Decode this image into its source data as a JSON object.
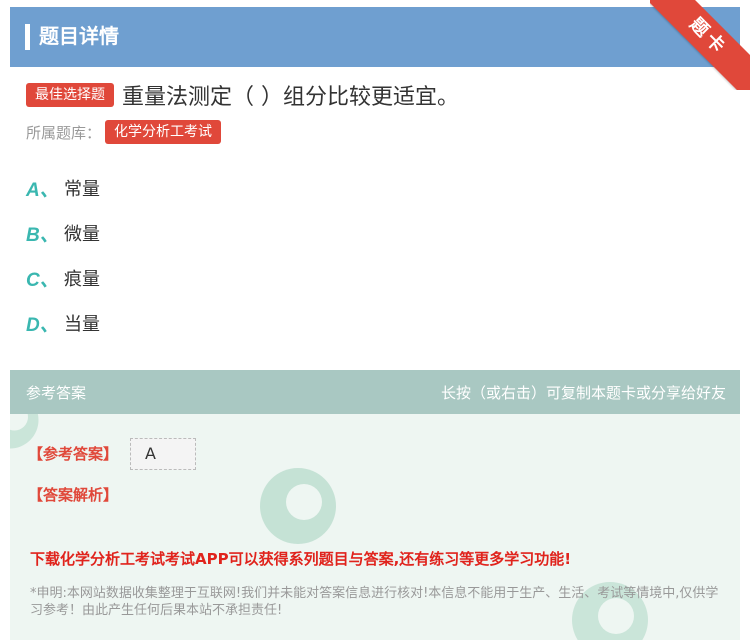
{
  "header": {
    "title": "题目详情",
    "ribbon": "题卡"
  },
  "question": {
    "type_tag": "最佳选择题",
    "text": "重量法测定（ ）组分比较更适宜。",
    "bank_label": "所属题库：",
    "bank_tag": "化学分析工考试"
  },
  "options": [
    {
      "letter": "A、",
      "text": "常量"
    },
    {
      "letter": "B、",
      "text": "微量"
    },
    {
      "letter": "C、",
      "text": "痕量"
    },
    {
      "letter": "D、",
      "text": "当量"
    }
  ],
  "answer_panel": {
    "title": "参考答案",
    "copy_hint": "长按（或右击）可复制本题卡或分享给好友",
    "ref_label": "【参考答案】",
    "answer": "A",
    "analysis_label": "【答案解析】",
    "promo": "下载化学分析工考试考试APP可以获得系列题目与答案,还有练习等更多学习功能!",
    "disclaimer": "*申明:本网站数据收集整理于互联网!我们并未能对答案信息进行核对!本信息不能用于生产、生活、考试等情境中,仅供学习参考！由此产生任何后果本站不承担责任!"
  },
  "colors": {
    "header": "#6f9fd0",
    "accent_red": "#e0483a",
    "option_letter": "#3ab7b0",
    "answer_head": "#a9c8c2",
    "answer_bg": "#eef6f2"
  }
}
